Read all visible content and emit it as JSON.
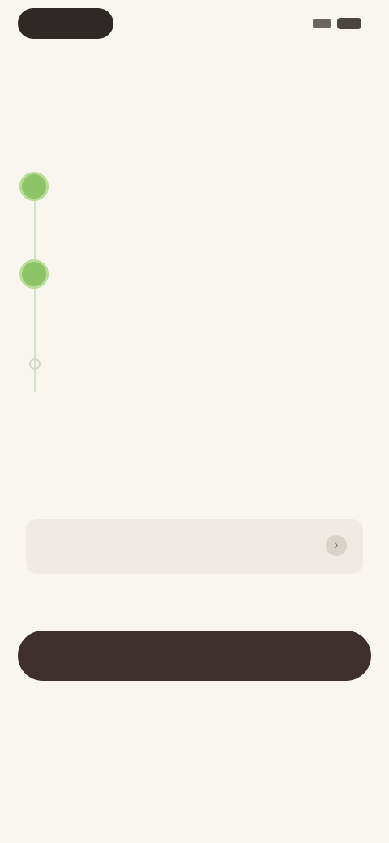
{
  "status_bar": {
    "time": "",
    "icons": [
      "signal-icon",
      "battery-icon"
    ]
  },
  "title": "",
  "timeline": [
    {
      "title": "",
      "description": "",
      "state": "done"
    },
    {
      "title": "",
      "description": "",
      "state": "done"
    },
    {
      "title": "",
      "description": "",
      "state": "upcoming"
    }
  ],
  "note": {
    "text": "",
    "link": ""
  },
  "plan": {
    "label": "",
    "icon": "chevron-icon"
  },
  "small_note": "",
  "cta_label": "",
  "secondary_label": "",
  "footer_text": "",
  "colors": {
    "background": "#f8f6ef",
    "accent": "#8dc468",
    "cta": "#3e2f2a"
  }
}
